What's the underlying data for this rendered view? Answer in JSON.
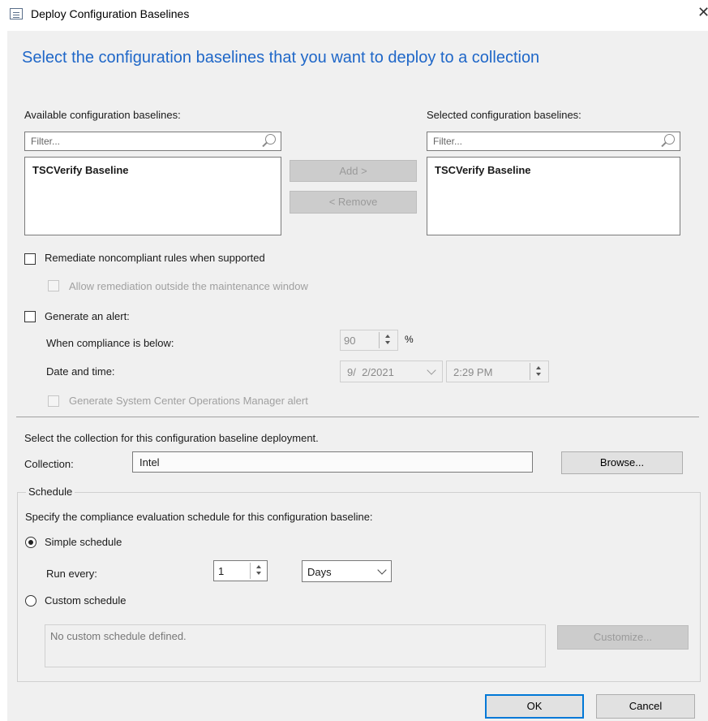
{
  "window": {
    "title": "Deploy Configuration Baselines",
    "close_glyph": "✕"
  },
  "headline": "Select the configuration baselines that you want to deploy to a collection",
  "available": {
    "label": "Available configuration baselines:",
    "filter_placeholder": "Filter...",
    "items": [
      "TSCVerify Baseline"
    ]
  },
  "selected": {
    "label": "Selected configuration baselines:",
    "filter_placeholder": "Filter...",
    "items": [
      "TSCVerify Baseline"
    ]
  },
  "buttons": {
    "add": "Add >",
    "remove": "< Remove",
    "browse": "Browse...",
    "customize": "Customize...",
    "ok": "OK",
    "cancel": "Cancel"
  },
  "options": {
    "remediate": "Remediate noncompliant rules when supported",
    "allow_remediation": "Allow remediation outside the maintenance window",
    "generate_alert": "Generate an alert:",
    "compliance_below_label": "When compliance is below:",
    "compliance_value": "90",
    "percent": "%",
    "date_time_label": "Date and time:",
    "date_value": "9/  2/2021",
    "time_value": "2:29 PM",
    "scom_alert": "Generate System Center Operations Manager alert"
  },
  "collection": {
    "instruction": "Select the collection for this configuration baseline deployment.",
    "label": "Collection:",
    "value": "Intel"
  },
  "schedule": {
    "group_label": "Schedule",
    "instruction": "Specify the compliance evaluation schedule for this configuration baseline:",
    "simple_label": "Simple schedule",
    "run_every_label": "Run every:",
    "run_every_value": "1",
    "unit_value": "Days",
    "custom_label": "Custom schedule",
    "custom_text": "No custom schedule defined.",
    "selected": "simple"
  },
  "icons": [
    "window-icon",
    "close-icon",
    "search-icon",
    "spinner-arrows-icon",
    "chevron-down-icon"
  ]
}
